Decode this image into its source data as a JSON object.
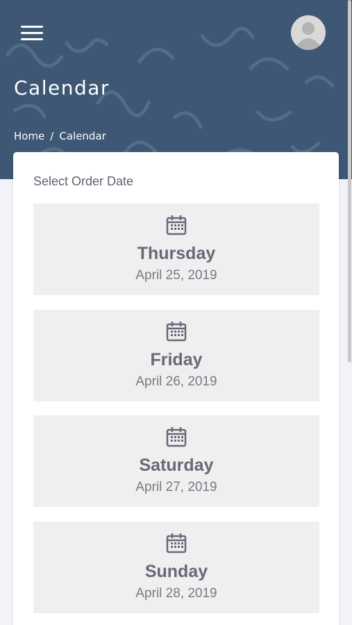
{
  "header": {
    "title": "Calendar",
    "menu_icon": "hamburger-menu-icon",
    "avatar_icon": "user-avatar-icon",
    "background_color": "#3d5775"
  },
  "breadcrumb": {
    "home": "Home",
    "separator": "/",
    "current": "Calendar"
  },
  "card": {
    "title": "Select Order Date",
    "dates": [
      {
        "day": "Thursday",
        "date": "April 25, 2019",
        "icon": "calendar-icon"
      },
      {
        "day": "Friday",
        "date": "April 26, 2019",
        "icon": "calendar-icon"
      },
      {
        "day": "Saturday",
        "date": "April 27, 2019",
        "icon": "calendar-icon"
      },
      {
        "day": "Sunday",
        "date": "April 28, 2019",
        "icon": "calendar-icon"
      }
    ]
  },
  "colors": {
    "text_primary": "#666977",
    "item_background": "#efefef",
    "page_background": "#f2f3f8"
  }
}
